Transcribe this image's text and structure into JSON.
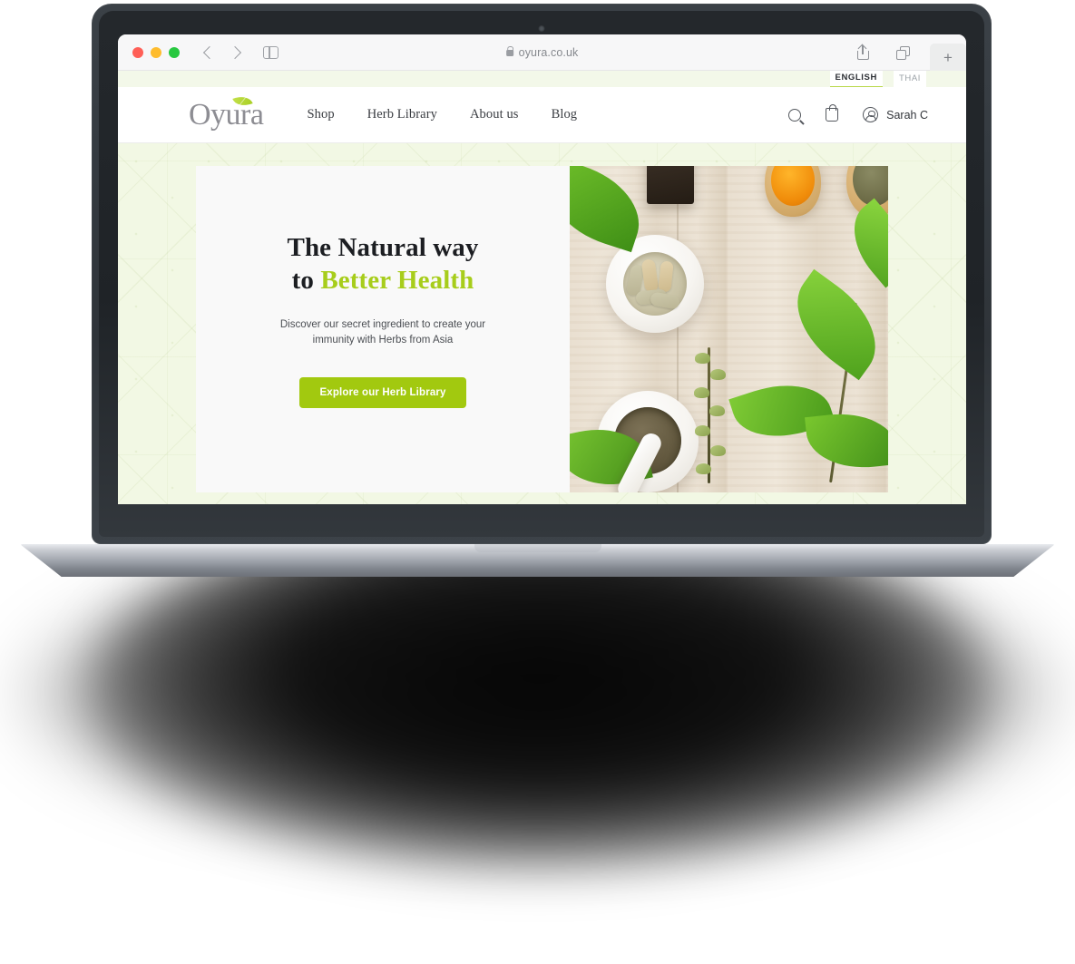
{
  "browser": {
    "url": "oyura.co.uk",
    "lock_icon": "lock-icon",
    "back_icon": "chevron-left-icon",
    "forward_icon": "chevron-right-icon",
    "sidebar_icon": "sidebar-toggle-icon",
    "share_icon": "share-icon",
    "tabs_icon": "tab-overview-icon",
    "new_tab_label": "+"
  },
  "site": {
    "language_bar": {
      "languages": [
        {
          "label": "ENGLISH",
          "active": true
        },
        {
          "label": "THAI",
          "active": false
        }
      ]
    },
    "header": {
      "logo_text": "Oyura",
      "nav": [
        {
          "label": "Shop"
        },
        {
          "label": "Herb Library"
        },
        {
          "label": "About us"
        },
        {
          "label": "Blog"
        }
      ],
      "search_icon": "search-icon",
      "cart_icon": "shopping-bag-icon",
      "account": {
        "avatar_icon": "user-avatar-icon",
        "name": "Sarah C"
      }
    },
    "hero": {
      "heading_line1": "The Natural way",
      "heading_line2_prefix": "to ",
      "heading_line2_accent": "Better Health",
      "subtitle": "Discover our secret ingredient to create your immunity with Herbs from Asia",
      "cta_label": "Explore our Herb Library",
      "image_alt": "Flat lay of herbal supplements, mortar and pestle, wooden spoons with turmeric and dried herbs on light wood"
    }
  },
  "colors": {
    "brand_green": "#a2c90f",
    "accent_heading_green": "#a7cd1b",
    "logo_gray": "#8d8d93",
    "page_bg": "#f2f8e4",
    "hero_panel_bg": "#f9f9f9",
    "traffic_red": "#ff5f57",
    "traffic_amber": "#febc2e",
    "traffic_green": "#28c840"
  }
}
